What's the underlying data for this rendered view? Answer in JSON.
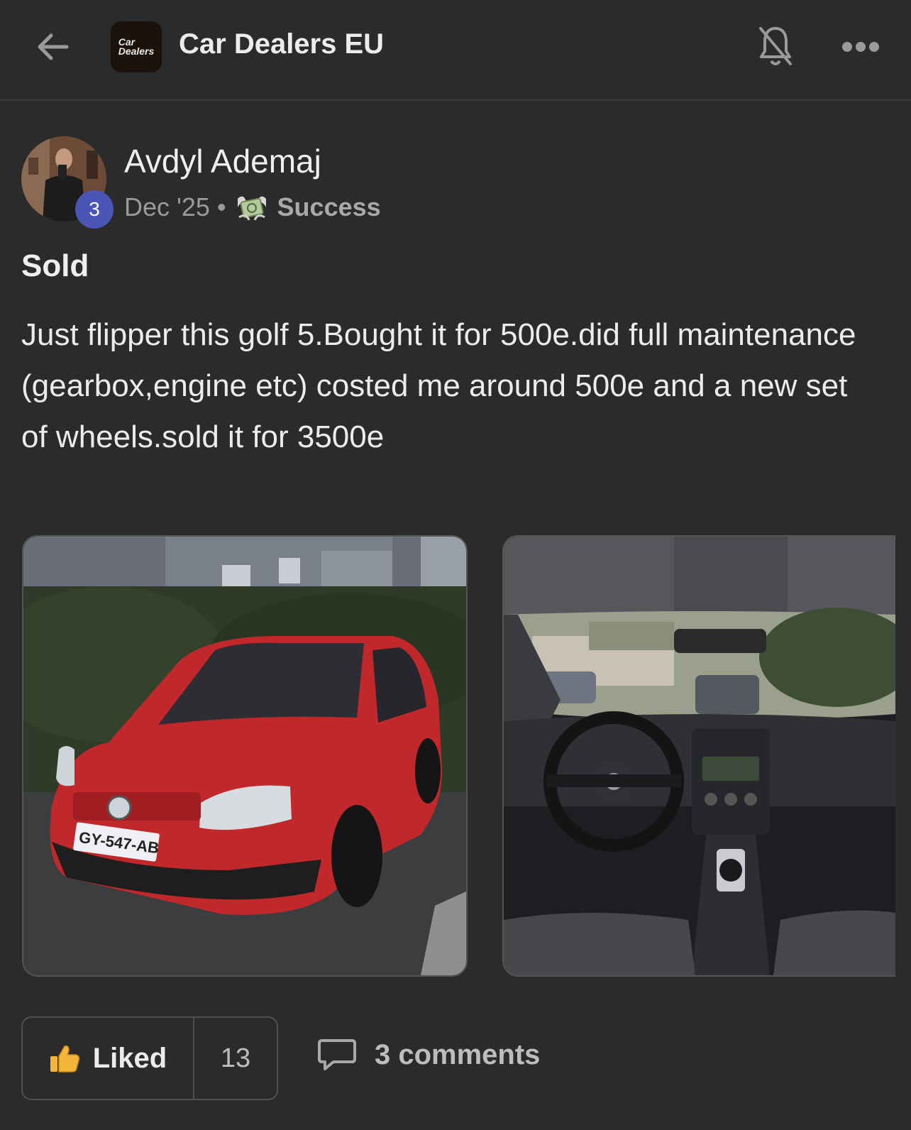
{
  "header": {
    "group_name": "Car Dealers EU",
    "logo_line1": "Car",
    "logo_line2": "Dealers",
    "back_icon": "arrow-left-icon",
    "bell_icon": "bell-off-icon",
    "more_icon": "more-horizontal-icon"
  },
  "post": {
    "author": "Avdyl Ademaj",
    "level": "3",
    "date": "Dec '25",
    "separator": "•",
    "category": "Success",
    "category_icon": "money-with-wings-icon",
    "title": "Sold",
    "body": "Just flipper this golf 5.Bought it for 500e.did full maintenance (gearbox,engine etc) costed me around 500e and a new set of wheels.sold it for 3500e",
    "images": [
      {
        "name": "red-golf-exterior-photo",
        "plate": "GY-547-AB"
      },
      {
        "name": "golf-interior-photo"
      }
    ]
  },
  "actions": {
    "like_label": "Liked",
    "like_count": "13",
    "comments_label": "3 comments"
  },
  "colors": {
    "background": "#2b2b2c",
    "level_badge": "#4b55b5",
    "car_red": "#c0282c"
  }
}
